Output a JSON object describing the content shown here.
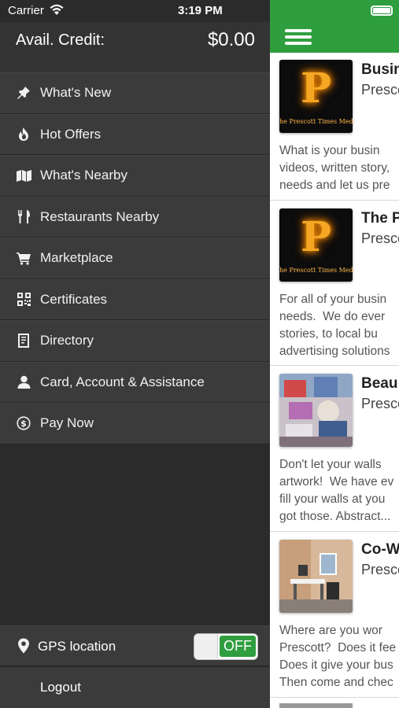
{
  "status_bar": {
    "carrier": "Carrier",
    "time": "3:19 PM"
  },
  "drawer": {
    "credit_label": "Avail. Credit:",
    "credit_value": "$0.00",
    "menu": [
      {
        "label": "What's New",
        "icon": "pin-icon"
      },
      {
        "label": "Hot Offers",
        "icon": "fire-icon"
      },
      {
        "label": "What's Nearby",
        "icon": "map-icon"
      },
      {
        "label": "Restaurants Nearby",
        "icon": "utensils-icon"
      },
      {
        "label": "Marketplace",
        "icon": "cart-icon"
      },
      {
        "label": "Certificates",
        "icon": "qr-code-icon"
      },
      {
        "label": "Directory",
        "icon": "address-book-icon"
      },
      {
        "label": "Card, Account & Assistance",
        "icon": "user-icon"
      },
      {
        "label": "Pay Now",
        "icon": "dollar-circle-icon"
      }
    ],
    "gps_label": "GPS location",
    "gps_toggle": "OFF",
    "logout_label": "Logout"
  },
  "content": {
    "accent": "#2f9e3e",
    "cards": [
      {
        "title": "Busin",
        "subtitle": "Presco",
        "logo_text": "P",
        "logo_subtext": "he Prescott Times Med",
        "desc": "What is your busin\nvideos, written story,\nneeds and let us pre"
      },
      {
        "title": "The P",
        "subtitle": "Presco",
        "logo_text": "P",
        "logo_subtext": "he Prescott Times Med",
        "desc": "For all of your busin\nneeds.  We do ever\nstories, to local bu\nadvertising solutions"
      },
      {
        "title": "Beau",
        "subtitle": "Presco",
        "desc": "Don't let your walls\nartwork!  We have ev\nfill your walls at you\ngot those. Abstract..."
      },
      {
        "title": "Co-W",
        "subtitle": "Presco",
        "desc": "Where are you wor\nPrescott?  Does it fee\nDoes it give your bus\nThen come and chec"
      }
    ]
  }
}
